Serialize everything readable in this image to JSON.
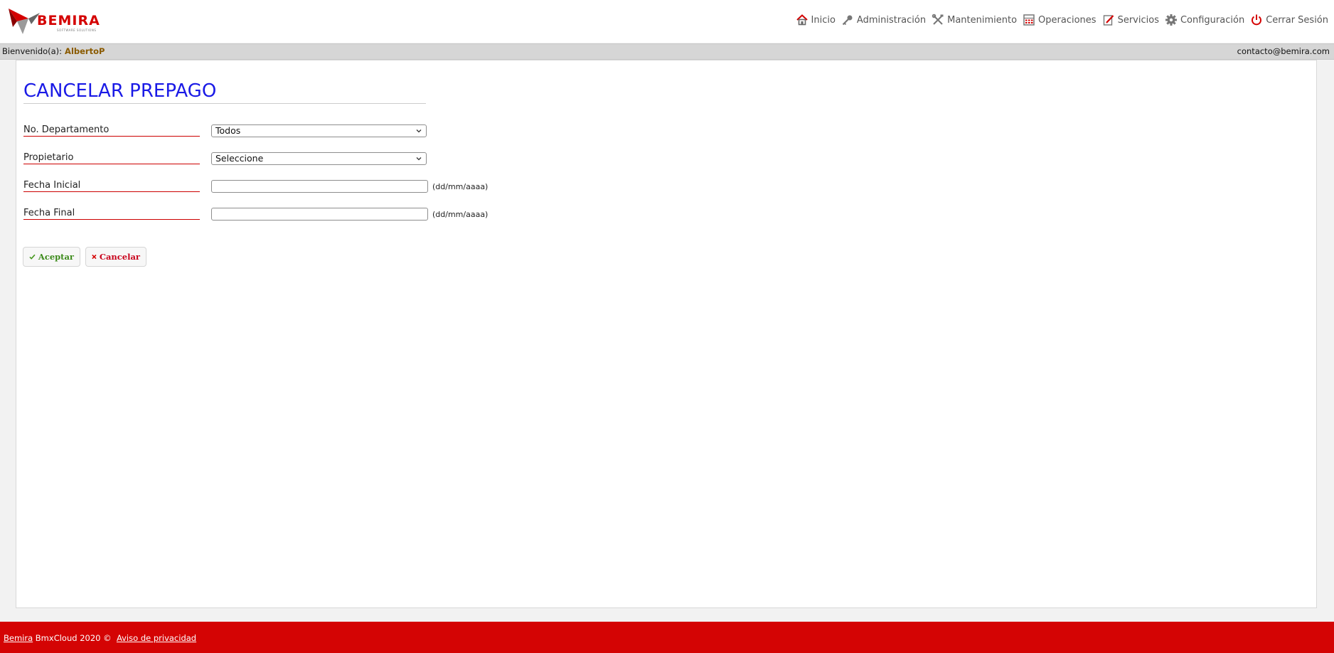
{
  "brand": {
    "name": "BEMIRA",
    "tagline": "SOFTWARE SOLUTIONS",
    "accent_color": "#d40000"
  },
  "nav": {
    "items": [
      {
        "label": "Inicio",
        "icon": "home-icon"
      },
      {
        "label": "Administración",
        "icon": "key-icon"
      },
      {
        "label": "Mantenimiento",
        "icon": "tools-icon"
      },
      {
        "label": "Operaciones",
        "icon": "calculator-icon"
      },
      {
        "label": "Servicios",
        "icon": "edit-icon"
      },
      {
        "label": "Configuración",
        "icon": "gear-icon"
      },
      {
        "label": "Cerrar Sesión",
        "icon": "power-icon"
      }
    ]
  },
  "welcome": {
    "prefix": "Bienvenido(a):",
    "user": "AlbertoP",
    "contact": "contacto@bemira.com"
  },
  "page": {
    "title": "CANCELAR PREPAGO"
  },
  "form": {
    "departamento_label": "No. Departamento",
    "departamento_value": "Todos",
    "propietario_label": "Propietario",
    "propietario_value": "Seleccione",
    "fecha_inicial_label": "Fecha Inicial",
    "fecha_inicial_value": "",
    "fecha_final_label": "Fecha Final",
    "fecha_final_value": "",
    "date_hint": "(dd/mm/aaaa)",
    "accept_label": "Aceptar",
    "cancel_label": "Cancelar"
  },
  "footer": {
    "brand_link": "Bemira",
    "copyright": "BmxCloud 2020 ©",
    "privacy_link": "Aviso de privacidad"
  }
}
